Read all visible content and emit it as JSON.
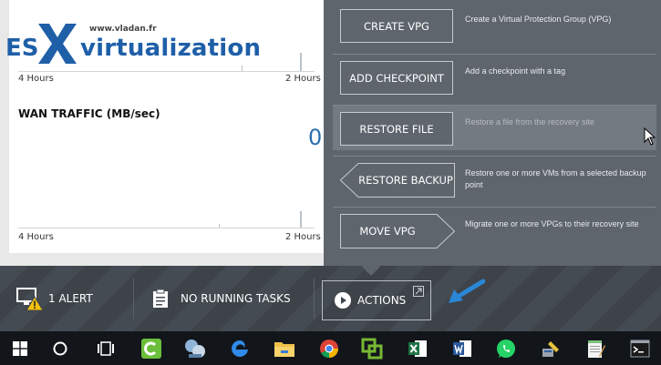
{
  "logo": {
    "url": "www.vladan.fr",
    "prefix": "ES",
    "suffix": "virtualization"
  },
  "charts": [
    {
      "left_label": "4 Hours",
      "right_label": "2 Hours"
    },
    {
      "left_label": "4 Hours",
      "right_label": "2 Hours"
    }
  ],
  "wan": {
    "title": "WAN TRAFFIC (MB/sec)",
    "value": "0"
  },
  "actions_menu": [
    {
      "label": "CREATE VPG",
      "description": "Create a Virtual Protection Group (VPG)"
    },
    {
      "label": "ADD CHECKPOINT",
      "description": "Add a checkpoint with a tag"
    },
    {
      "label": "RESTORE FILE",
      "description": "Restore a file from the recovery site"
    },
    {
      "label": "RESTORE BACKUP",
      "description": "Restore one or more VMs from a selected backup point"
    },
    {
      "label": "MOVE VPG",
      "description": "Migrate one or more VPGs to their recovery site"
    }
  ],
  "statusbar": {
    "alerts_label": "1 ALERT",
    "tasks_label": "NO RUNNING TASKS",
    "actions_label": "ACTIONS"
  },
  "colors": {
    "panel": "#5e656d",
    "hover_row": "#737a82",
    "accent_blue": "#2a87d6",
    "alert_yellow": "#f4c20d"
  },
  "taskbar_icons": [
    "windows-start-icon",
    "cortana-icon",
    "task-view-icon",
    "camtasia-icon",
    "network-tool-icon",
    "edge-icon",
    "file-explorer-icon",
    "chrome-icon",
    "vmware-icon",
    "excel-icon",
    "word-icon",
    "whatsapp-icon",
    "sql-tool-icon",
    "notepad-icon",
    "cmd-icon"
  ]
}
